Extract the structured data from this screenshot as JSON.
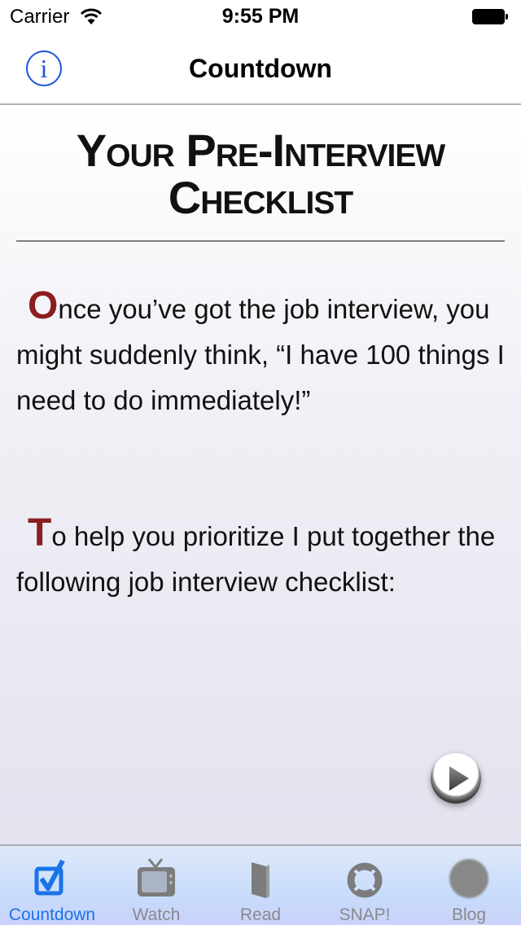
{
  "status_bar": {
    "carrier": "Carrier",
    "time": "9:55 PM",
    "wifi_icon": "wifi-icon",
    "battery_icon": "battery-full-icon"
  },
  "nav": {
    "title": "Countdown",
    "info_icon": "info-icon",
    "info_glyph": "i"
  },
  "content": {
    "heading_line1": "Your Pre-Interview",
    "heading_line2": "Checklist",
    "paragraphs": [
      {
        "dropcap": "O",
        "text": "nce you’ve got the job interview, you might suddenly think, “I have 100 things I need to do immediately!”"
      },
      {
        "dropcap": "T",
        "text": "o help you prioritize I put together the following job interview checklist:"
      }
    ],
    "play_icon": "play-icon",
    "accent_color": "#8b1e1e"
  },
  "tabs": [
    {
      "label": "Countdown",
      "icon": "checkbox-checked-icon",
      "active": true
    },
    {
      "label": "Watch",
      "icon": "tv-icon",
      "active": false
    },
    {
      "label": "Read",
      "icon": "book-icon",
      "active": false
    },
    {
      "label": "SNAP!",
      "icon": "lifebuoy-icon",
      "active": false
    },
    {
      "label": "Blog",
      "icon": "blog-circle-icon",
      "active": false
    }
  ],
  "colors": {
    "tab_active": "#1a74e8",
    "tab_inactive": "#8a8a8a",
    "info_blue": "#1d55d6"
  }
}
